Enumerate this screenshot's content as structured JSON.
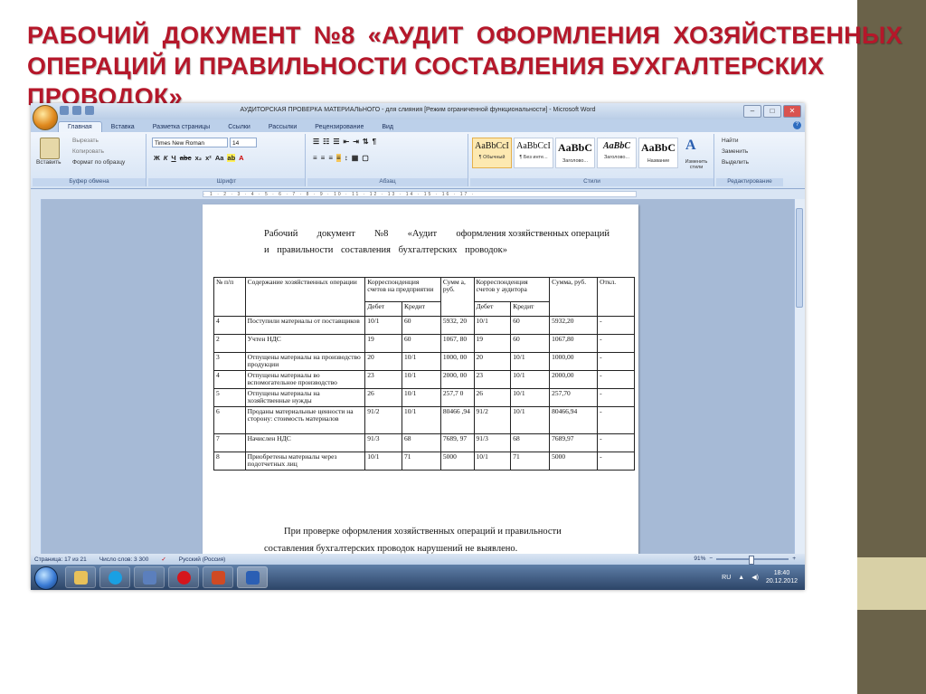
{
  "slide": {
    "title_line1": [
      "РАБОЧИЙ",
      "ДОКУМЕНТ",
      "№8",
      "«АУДИТ",
      "ОФОРМЛЕНИЯ",
      "ХОЗЯЙСТВЕННЫХ"
    ],
    "title_line2": "ОПЕРАЦИЙ И ПРАВИЛЬНОСТИ СОСТАВЛЕНИЯ БУХГАЛТЕРСКИХ ПРОВОДОК»",
    "colors": {
      "title": "#b5172a",
      "bar_dark": "#6a6249",
      "bar_accent": "#d8d0a6"
    }
  },
  "window": {
    "title": "АУДИТОРСКАЯ ПРОВЕРКА МАТЕРИАЛЬНОГО - для слияния [Режим ограниченной функциональности] - Microsoft Word"
  },
  "ribbon_tabs": [
    "Главная",
    "Вставка",
    "Разметка страницы",
    "Ссылки",
    "Рассылки",
    "Рецензирование",
    "Вид"
  ],
  "ribbon": {
    "clipboard": {
      "paste": "Вставить",
      "cut": "Вырезать",
      "copy": "Копировать",
      "format_painter": "Формат по образцу",
      "label": "Буфер обмена"
    },
    "font": {
      "name": "Times New Roman",
      "size": "14",
      "label": "Шрифт"
    },
    "paragraph": {
      "label": "Абзац"
    },
    "styles": {
      "items": [
        {
          "sample": "AaBbCcI",
          "name": "¶ Обычный"
        },
        {
          "sample": "AaBbCcI",
          "name": "¶ Без инте..."
        },
        {
          "sample": "AaBbC",
          "name": "Заголово..."
        },
        {
          "sample": "AaBbC",
          "name": "Заголово..."
        },
        {
          "sample": "AaBbC",
          "name": "Название"
        }
      ],
      "change_styles": "Изменить стили",
      "label": "Стили"
    },
    "editing": {
      "find": "Найти",
      "replace": "Заменить",
      "select": "Выделить",
      "label": "Редактирование"
    }
  },
  "document": {
    "title_line1": [
      "Рабочий",
      "документ",
      "№8",
      "«Аудит",
      "оформления хозяйственных операций"
    ],
    "title_line2": "и правильности составления бухгалтерских проводок»",
    "headers": {
      "num": "№ п/п",
      "desc": "Содержание хозяйственных операции",
      "corr_enterprise": "Корреспонденция счетов на предприятии",
      "sum": "Сумм а, руб.",
      "corr_auditor": "Корреспонденция счетов у аудитора",
      "sum_auditor": "Сумма, руб.",
      "deviation": "Откл.",
      "debit": "Дебет",
      "credit": "Кредит"
    },
    "rows": [
      {
        "n": "4",
        "desc": "Поступили материалы от поставщиков",
        "deb": "10/1",
        "cred": "60",
        "sum": "5932, 20",
        "adeb": "10/1",
        "acred": "60",
        "asum": "5932,20",
        "dev": "-"
      },
      {
        "n": "2",
        "desc": "Учтен НДС",
        "deb": "19",
        "cred": "60",
        "sum": "1067, 80",
        "adeb": "19",
        "acred": "60",
        "asum": "1067,80",
        "dev": "-"
      },
      {
        "n": "3",
        "desc": "Отпущены материалы на производство продукции",
        "deb": "20",
        "cred": "10/1",
        "sum": "1000, 00",
        "adeb": "20",
        "acred": "10/1",
        "asum": "1000,00",
        "dev": "-"
      },
      {
        "n": "4",
        "desc": "Отпущены материалы во вспомогательное производство",
        "deb": "23",
        "cred": "10/1",
        "sum": "2000, 00",
        "adeb": "23",
        "acred": "10/1",
        "asum": "2000,00",
        "dev": "-"
      },
      {
        "n": "5",
        "desc": "Отпущены материалы на хозяйственные нужды",
        "deb": "26",
        "cred": "10/1",
        "sum": "257,7 0",
        "adeb": "26",
        "acred": "10/1",
        "asum": "257,70",
        "dev": "-"
      },
      {
        "n": "6",
        "desc": "Проданы материальные ценности на сторону: стоимость материалов",
        "deb": "91/2",
        "cred": "10/1",
        "sum": "80466 ,94",
        "adeb": "91/2",
        "acred": "10/1",
        "asum": "80466,94",
        "dev": "-"
      },
      {
        "n": "7",
        "desc": "Начислен НДС",
        "deb": "91/3",
        "cred": "68",
        "sum": "7689, 97",
        "adeb": "91/3",
        "acred": "68",
        "asum": "7689,97",
        "dev": "-"
      },
      {
        "n": "8",
        "desc": "Приобретены материалы через подотчетных лиц",
        "deb": "10/1",
        "cred": "71",
        "sum": "5000",
        "adeb": "10/1",
        "acred": "71",
        "asum": "5000",
        "dev": "-"
      }
    ],
    "footer_line1": "При проверке оформления хозяйственных операций и правильности",
    "footer_line2": "составления бухгалтерских проводок нарушений не выявлено."
  },
  "status": {
    "page": "Страница: 17 из 21",
    "words": "Число слов: 3 300",
    "language": "Русский (Россия)",
    "zoom": "91%"
  },
  "tray": {
    "lang": "RU",
    "time": "18:40",
    "date": "20.12.2012"
  }
}
